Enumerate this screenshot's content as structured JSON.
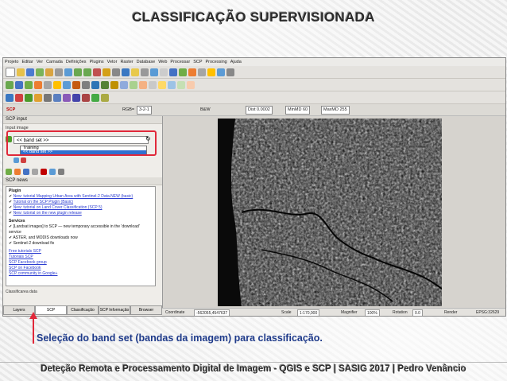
{
  "slide": {
    "title": "CLASSIFICAÇÃO SUPERVISIONADA",
    "caption": "Seleção do band set (bandas da imagem) para classificação.",
    "footer": "Deteção Remota e Processamento Digital de Imagem - QGIS e SCP   |   SASIG 2017   |   Pedro Venâncio"
  },
  "menubar": [
    "Projeto",
    "Editar",
    "Ver",
    "Camada",
    "Definições",
    "Plugins",
    "Vetor",
    "Raster",
    "Database",
    "Web",
    "Processar",
    "SCP",
    "Processing",
    "Ajuda"
  ],
  "scp_toolbar": {
    "label": "RGB=",
    "zoom_field": "Dist 0.0002",
    "rgb_value": "3-2-1",
    "band_label": "B&W",
    "ms_field": "MinMD 60",
    "ms_label": "MaxMD 255"
  },
  "panel": {
    "title": "SCP input",
    "input_section": "Input image",
    "band_set_value": "<< band set >>",
    "dropdown_options": [
      "Training",
      "<< band set >>"
    ],
    "news_header": "SCP news",
    "news": {
      "plugin_title": "Plugin",
      "items": [
        "New: tutorial Mapping Urban Area with Sentinel-2 Data.NEW (basic)",
        "Tutorial on the SCP Plugin (Basic)",
        "New: tutorial on Land Cover Classification (SCP 5) ",
        "New: tutorial on the new plugin release"
      ],
      "services_title": "Services",
      "services": [
        "[Landsat images] to SCP — new temporary accessible in the 'download' service",
        "ASTER, and MODIS downloads now",
        "Sentinel-2 download fix"
      ],
      "links": [
        "Free tutorials SCP",
        "Tutorials SCP",
        "SCP Facebook group",
        "SCP on Facebook",
        "SCP community in Google+"
      ]
    },
    "classifier_label": "Classificarea data",
    "tabs": [
      "Layers",
      "SCP",
      "Classificação",
      "SCP Informação",
      "Browser"
    ]
  },
  "statusbar": {
    "coord_label": "Coordinate",
    "coord_value": "-562055,4547637",
    "scale_label": "Scale",
    "scale_value": "1:170,000",
    "magnifier_label": "Magnifier",
    "magnifier_value": "100%",
    "rotation_label": "Rotation",
    "rotation_value": "0.0",
    "render_label": "Render",
    "crs": "EPSG:32629"
  },
  "colors": {
    "highlight_box": "#e0283a",
    "caption": "#1e3a8a",
    "selection": "#3070d0"
  }
}
